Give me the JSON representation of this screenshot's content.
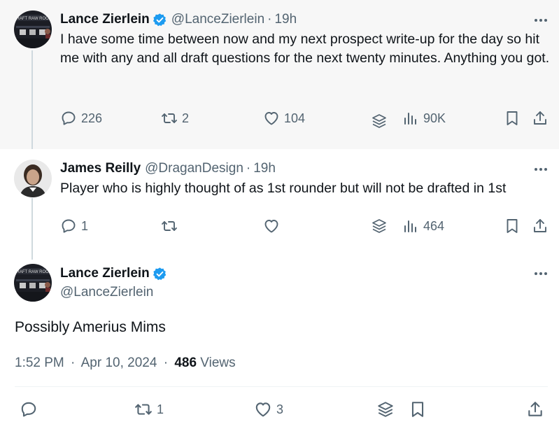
{
  "tweet1": {
    "name": "Lance Zierlein",
    "handle": "@LanceZierlein",
    "time": "19h",
    "text": "I have some time between now and my next prospect write-up for the day so hit me with any and all draft questions for the next twenty minutes. Anything you got.",
    "replies": "226",
    "reposts": "2",
    "likes": "104",
    "views": "90K"
  },
  "tweet2": {
    "name": "James Reilly",
    "handle": "@DraganDesign",
    "time": "19h",
    "text": "Player who is highly thought of as 1st rounder but will not be drafted in 1st",
    "replies": "1",
    "reposts": "",
    "likes": "",
    "views": "464"
  },
  "main_tweet": {
    "name": "Lance Zierlein",
    "handle": "@LanceZierlein",
    "text": "Possibly Amerius Mims",
    "time": "1:52 PM",
    "date": "Apr 10, 2024",
    "views_count": "486",
    "views_label": "Views",
    "replies": "",
    "reposts": "1",
    "likes": "3"
  },
  "separator": "·",
  "colors": {
    "text": "#0f1419",
    "secondary": "#536471",
    "verified": "#1d9bf0",
    "thread_line": "#cfd9de",
    "highlight_bg": "#f7f7f7"
  },
  "icons": [
    "reply-icon",
    "repost-icon",
    "like-icon",
    "grok-icon",
    "views-icon",
    "bookmark-icon",
    "share-icon",
    "more-icon",
    "verified-badge-icon"
  ]
}
